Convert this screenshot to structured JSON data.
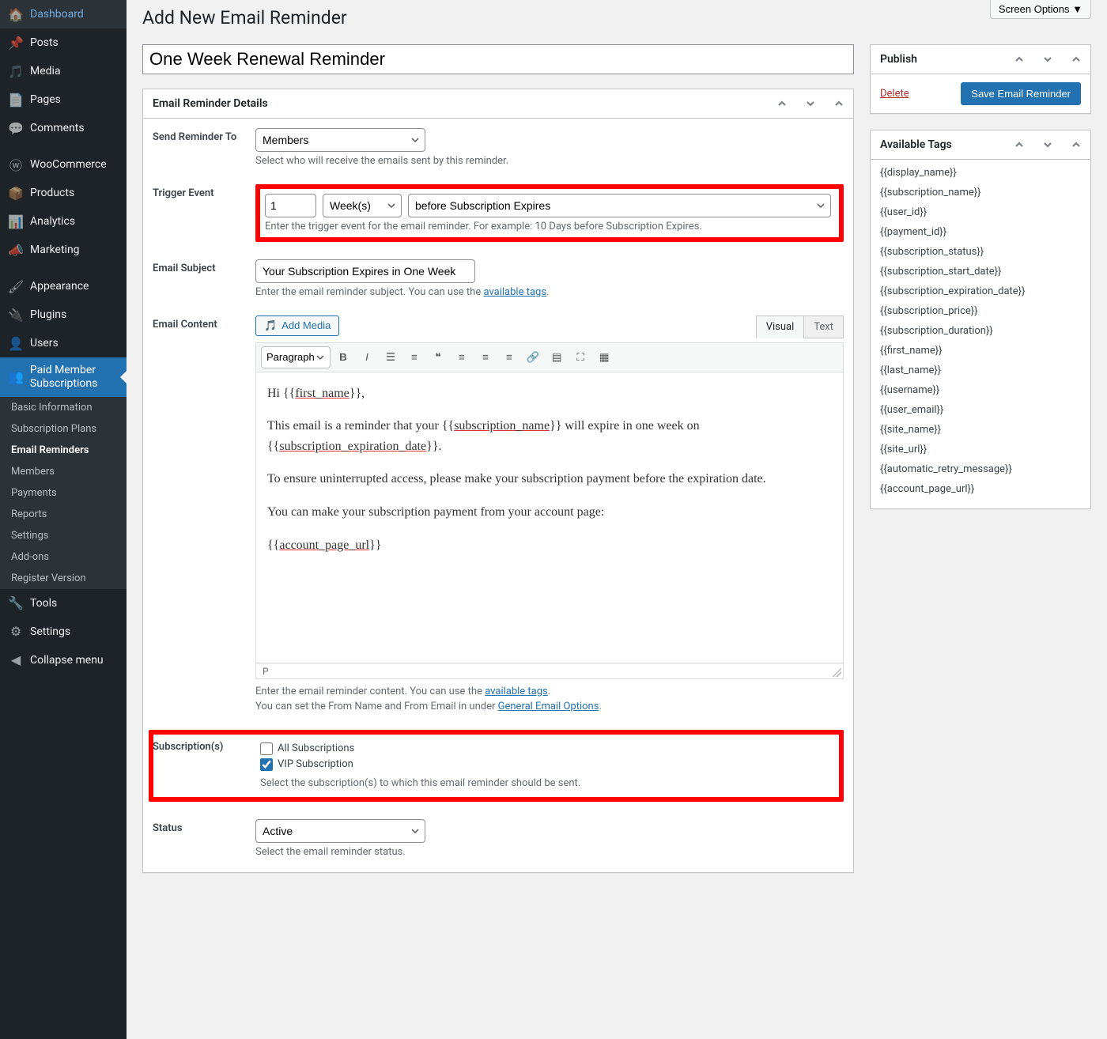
{
  "screen_options": "Screen Options ▼",
  "page_title": "Add New Email Reminder",
  "title_value": "One Week Renewal Reminder",
  "sidebar": {
    "items": [
      {
        "icon": "🏠",
        "label": "Dashboard"
      },
      {
        "icon": "📌",
        "label": "Posts"
      },
      {
        "icon": "🎵",
        "label": "Media"
      },
      {
        "icon": "📄",
        "label": "Pages"
      },
      {
        "icon": "💬",
        "label": "Comments"
      },
      {
        "icon": "ⓦ",
        "label": "WooCommerce"
      },
      {
        "icon": "📦",
        "label": "Products"
      },
      {
        "icon": "📊",
        "label": "Analytics"
      },
      {
        "icon": "📣",
        "label": "Marketing"
      },
      {
        "icon": "🖌",
        "label": "Appearance"
      },
      {
        "icon": "🔌",
        "label": "Plugins"
      },
      {
        "icon": "👤",
        "label": "Users"
      },
      {
        "icon": "👥",
        "label": "Paid Member Subscriptions"
      },
      {
        "icon": "🔧",
        "label": "Tools"
      },
      {
        "icon": "⚙",
        "label": "Settings"
      },
      {
        "icon": "◀",
        "label": "Collapse menu"
      }
    ],
    "submenu": [
      "Basic Information",
      "Subscription Plans",
      "Email Reminders",
      "Members",
      "Payments",
      "Reports",
      "Settings",
      "Add-ons",
      "Register Version"
    ]
  },
  "details": {
    "title": "Email Reminder Details",
    "send_to": {
      "label": "Send Reminder To",
      "value": "Members",
      "desc": "Select who will receive the emails sent by this reminder."
    },
    "trigger": {
      "label": "Trigger Event",
      "num": "1",
      "unit": "Week(s)",
      "when": "before Subscription Expires",
      "desc": "Enter the trigger event for the email reminder. For example: 10 Days before Subscription Expires."
    },
    "subject": {
      "label": "Email Subject",
      "value": "Your Subscription Expires in One Week",
      "desc": "Enter the email reminder subject. You can use the ",
      "link": "available tags"
    },
    "content": {
      "label": "Email Content",
      "add_media": "Add Media",
      "tab_visual": "Visual",
      "tab_text": "Text",
      "format": "Paragraph",
      "body_lines": {
        "l0": "Hi {{",
        "l0u": "first_name",
        "l0b": "}},",
        "l1": "This email is a reminder that your {{",
        "l1u": "subscription_name",
        "l1b": "}} will expire in one week on {{",
        "l1u2": "subscription_expiration_date",
        "l1c": "}}.",
        "l2": "To ensure uninterrupted access, please make your subscription payment before the expiration date.",
        "l3": "You can make your subscription payment from your account page:",
        "l4": "{{",
        "l4u": "account_page_url",
        "l4b": "}}"
      },
      "path": "P",
      "desc1": "Enter the email reminder content. You can use the ",
      "desc1_link": "available tags",
      "desc2": "You can set the From Name and From Email in under ",
      "desc2_link": "General Email Options"
    },
    "subs": {
      "label": "Subscription(s)",
      "opt1": "All Subscriptions",
      "opt2": "VIP Subscription",
      "desc": "Select the subscription(s) to which this email reminder should be sent."
    },
    "status": {
      "label": "Status",
      "value": "Active",
      "desc": "Select the email reminder status."
    }
  },
  "publish": {
    "title": "Publish",
    "delete": "Delete",
    "save": "Save Email Reminder"
  },
  "tags": {
    "title": "Available Tags",
    "list": [
      "{{display_name}}",
      "{{subscription_name}}",
      "{{user_id}}",
      "{{payment_id}}",
      "{{subscription_status}}",
      "{{subscription_start_date}}",
      "{{subscription_expiration_date}}",
      "{{subscription_price}}",
      "{{subscription_duration}}",
      "{{first_name}}",
      "{{last_name}}",
      "{{username}}",
      "{{user_email}}",
      "{{site_name}}",
      "{{site_url}}",
      "{{automatic_retry_message}}",
      "{{account_page_url}}"
    ]
  }
}
